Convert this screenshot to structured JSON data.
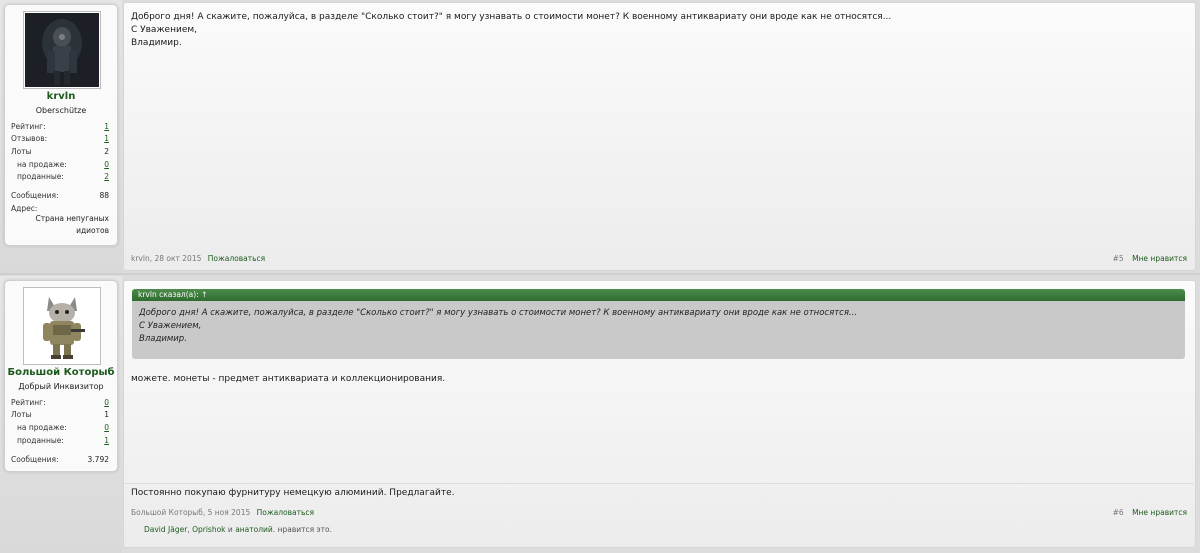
{
  "posts": [
    {
      "author": {
        "name": "krvln",
        "title": "Oberschütze",
        "stats": [
          {
            "label": "Рейтинг:",
            "value": "1",
            "link": true
          },
          {
            "label": "Отзывов:",
            "value": "1",
            "link": true
          },
          {
            "label": "Лоты",
            "value": "2",
            "link": false
          },
          {
            "label": "на продаже:",
            "value": "0",
            "link": true
          },
          {
            "label": "проданные:",
            "value": "2",
            "link": true
          },
          {
            "label": "Сообщения:",
            "value": "88",
            "link": false
          }
        ],
        "address_label": "Адрес:",
        "address_lines": [
          "Страна непуганых",
          "идиотов"
        ]
      },
      "message_lines": [
        "Доброго дня! А скажите, пожалуйса, в разделе \"Сколько стоит?\" я могу узнавать о стоимости монет? К военному антиквариату они вроде как не относятся...",
        "С Уважением,",
        "Владимир."
      ],
      "meta": {
        "author_date": "krvln, 28 окт 2015",
        "complain": "Пожаловаться"
      },
      "actions": {
        "number": "#5",
        "like": "Мне нравится"
      }
    },
    {
      "author": {
        "name": "Большой Которыб",
        "title": "Добрый Инквизитор",
        "stats": [
          {
            "label": "Рейтинг:",
            "value": "0",
            "link": true
          },
          {
            "label": "Лоты",
            "value": "1",
            "link": false
          },
          {
            "label": "на продаже:",
            "value": "0",
            "link": true
          },
          {
            "label": "проданные:",
            "value": "1",
            "link": true
          },
          {
            "label": "Сообщения:",
            "value": "3.792",
            "link": false
          }
        ]
      },
      "quote": {
        "header": "krvln сказал(а): ↑",
        "lines": [
          "Доброго дня! А скажите, пожалуйса, в разделе \"Сколько стоит?\" я могу узнавать о стоимости монет? К военному антиквариату они вроде как не относятся...",
          "С Уважением,",
          "Владимир."
        ]
      },
      "message": "можете. монеты - предмет антиквариата и коллекционирования.",
      "signature": "Постоянно покупаю фурнитуру немецкую алюминий. Предлагайте.",
      "meta": {
        "author_date": "Большой Которыб, 5 ноя 2015",
        "complain": "Пожаловаться"
      },
      "actions": {
        "number": "#6",
        "like": "Мне нравится"
      },
      "likes": {
        "user1": "David Jäger",
        "sep1": ", ",
        "user2": "Oprishok",
        "sep2": " и ",
        "user3": "анатолий",
        "suffix": ". нравится это."
      }
    }
  ],
  "colors": {
    "accent": "#1d5b1d",
    "quote_header": "#3f7d3f",
    "quote_bg": "#c9c9c9"
  },
  "icons": {
    "avatar1": "soldier-dark-avatar",
    "avatar2": "cat-soldier-avatar"
  }
}
